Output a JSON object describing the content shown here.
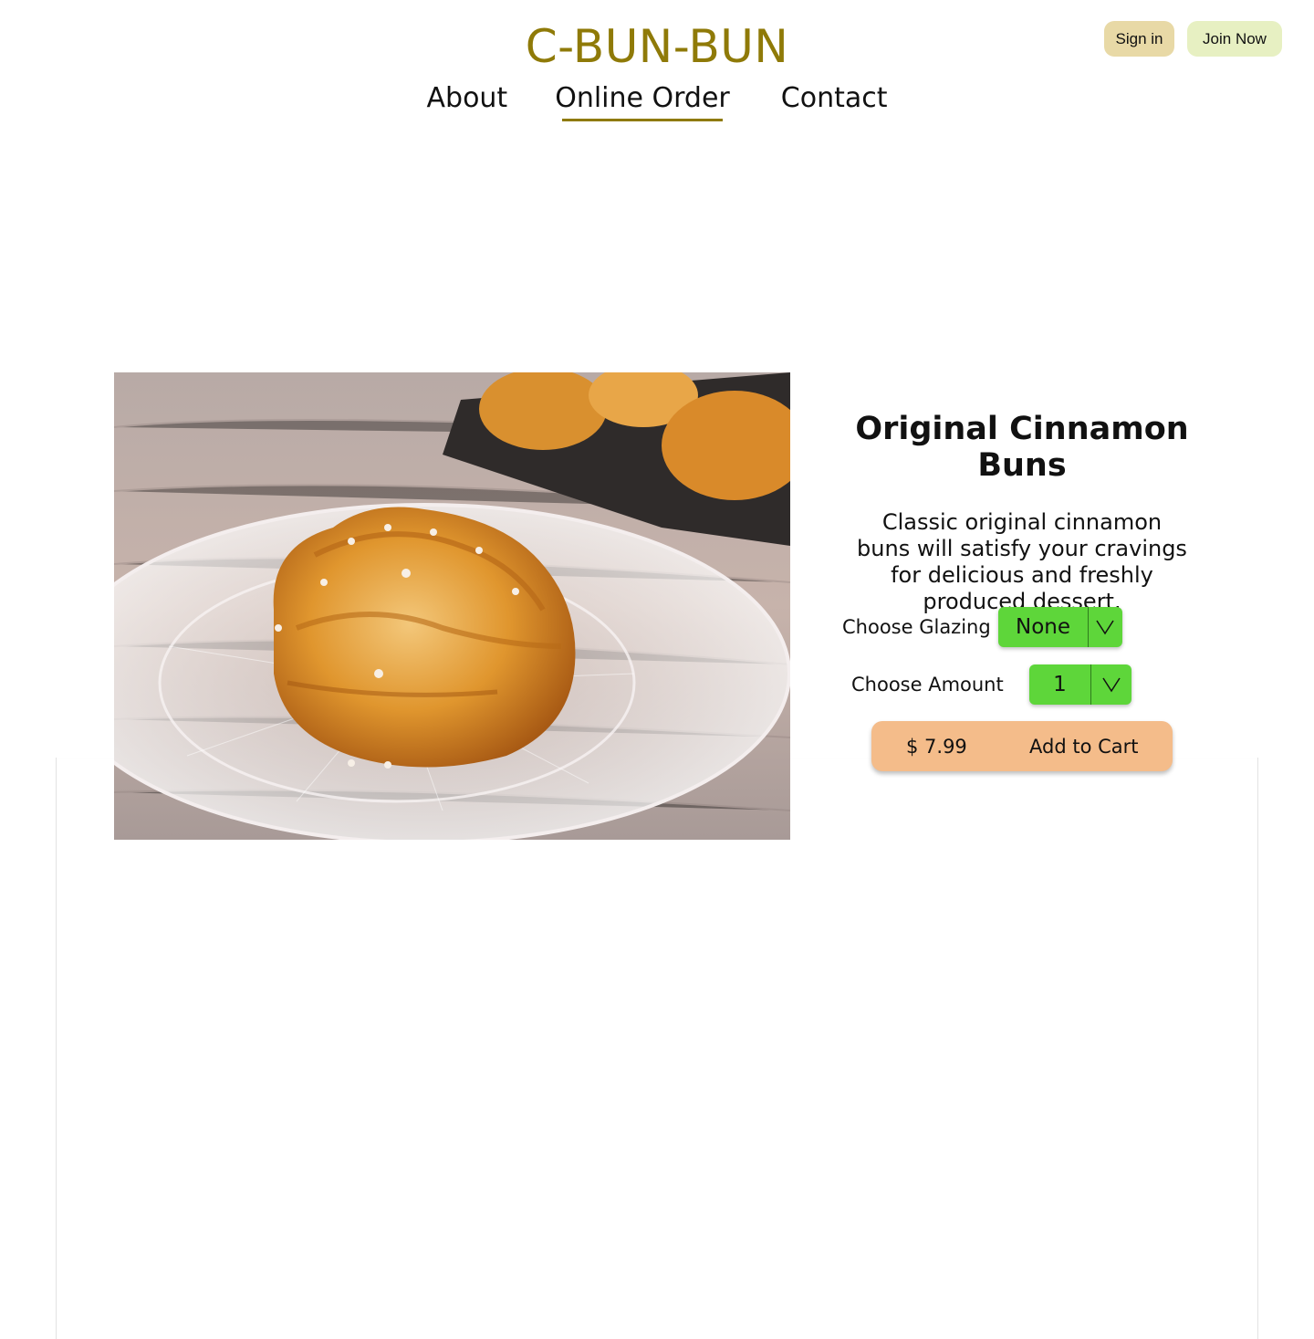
{
  "header": {
    "brand": "C-BUN-BUN",
    "sign_in_label": "Sign in",
    "join_now_label": "Join Now",
    "nav": {
      "about": "About",
      "online_order": "Online Order",
      "contact": "Contact"
    },
    "active_nav": "Online Order"
  },
  "product": {
    "title": "Original Cinnamon Buns",
    "description": "Classic original cinnamon buns will satisfy your cravings for delicious and freshly produced dessert.",
    "image_icon": "cinnamon-bun-photo",
    "glazing": {
      "label": "Choose Glazing",
      "selected": "None"
    },
    "amount": {
      "label": "Choose Amount",
      "selected": "1"
    },
    "price": "$ 7.99",
    "add_to_cart_label": "Add to Cart"
  },
  "colors": {
    "brand": "#8f7a08",
    "sign_in_bg": "#e8d9a6",
    "join_now_bg": "#e7f0c2",
    "select_bg": "#5ed63a",
    "cart_bg": "#f4bc8a"
  }
}
